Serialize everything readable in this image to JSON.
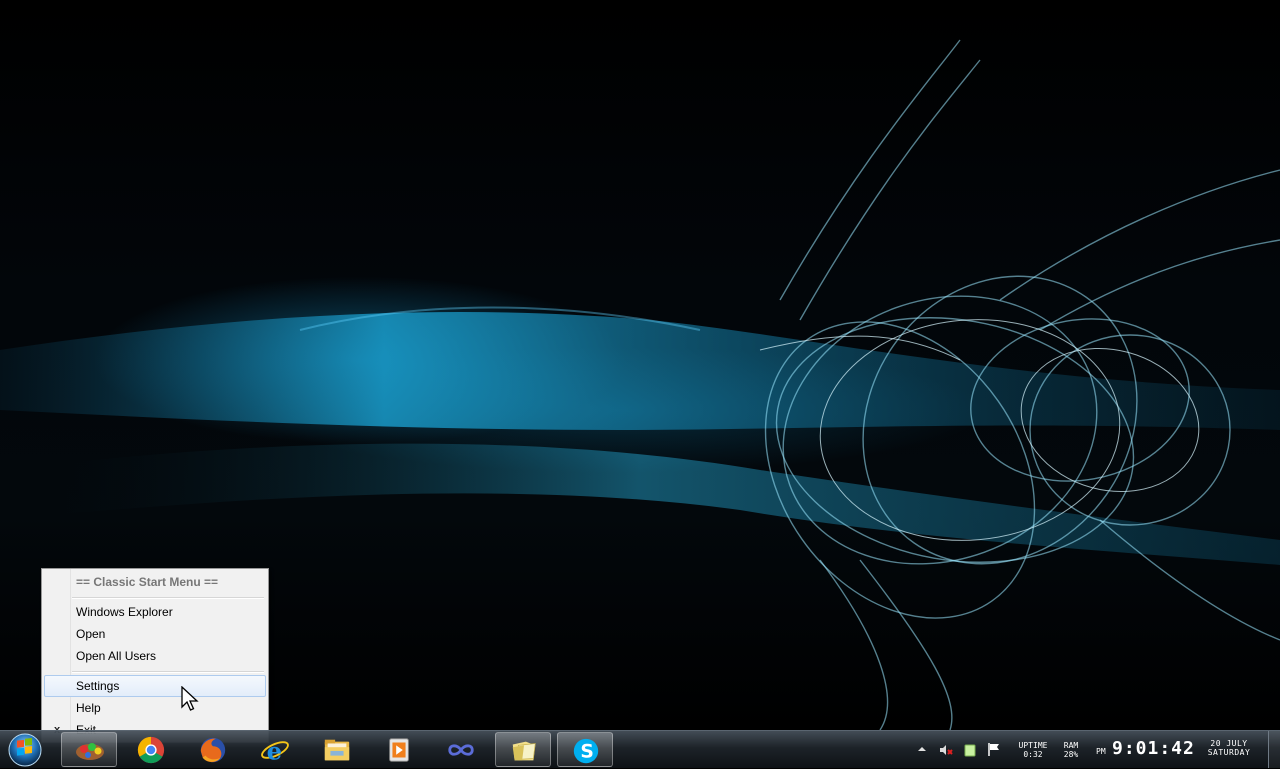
{
  "desktop": {
    "wallpaper": "abstract cyan light swirl on black"
  },
  "context_menu": {
    "header": "== Classic Start Menu ==",
    "items": [
      {
        "label": "Windows Explorer"
      },
      {
        "label": "Open"
      },
      {
        "label": "Open All Users"
      },
      {
        "label": "Settings",
        "selected": true
      },
      {
        "label": "Help"
      },
      {
        "label": "Exit",
        "mark": "x"
      }
    ]
  },
  "taskbar": {
    "start_button": "windows-orb-icon",
    "pinned": [
      {
        "name": "app-icon",
        "active": true
      },
      {
        "name": "chrome-icon"
      },
      {
        "name": "firefox-icon"
      },
      {
        "name": "internet-explorer-icon"
      },
      {
        "name": "file-explorer-icon"
      },
      {
        "name": "media-player-icon"
      },
      {
        "name": "infinity-app-icon"
      },
      {
        "name": "windows-explorer-window-icon",
        "active": true
      },
      {
        "name": "skype-icon",
        "active": true
      }
    ],
    "tray": {
      "uptime_label": "UPTIME",
      "uptime_value": "0:32",
      "ram_label": "RAM",
      "ram_value": "28%",
      "ampm": "PM",
      "time": "9:01:42",
      "date_line1": "20 JULY",
      "date_line2": "SATURDAY"
    },
    "colors": {
      "accent": "#2aa8d8",
      "taskbar": "#1b2026"
    }
  }
}
